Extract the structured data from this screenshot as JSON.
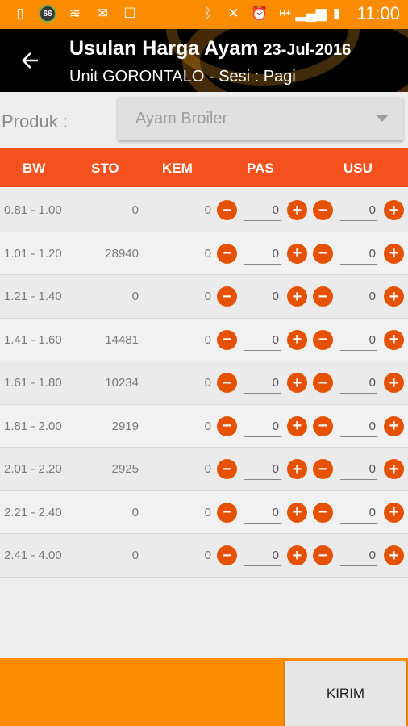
{
  "status_bar": {
    "badge": "66",
    "network": "H+",
    "time": "11:00"
  },
  "header": {
    "title": "Usulan Harga Ayam",
    "date": "23-Jul-2016",
    "subtitle": "Unit GORONTALO - Sesi : Pagi"
  },
  "produk": {
    "label": "Produk  :",
    "selected": "Ayam Broiler"
  },
  "table": {
    "columns": [
      "BW",
      "STO",
      "KEM",
      "PAS",
      "USU"
    ],
    "rows": [
      {
        "bw": "0.81 - 1.00",
        "sto": "0",
        "kem": "0",
        "pas": "0",
        "usu": "0"
      },
      {
        "bw": "1.01 - 1.20",
        "sto": "28940",
        "kem": "0",
        "pas": "0",
        "usu": "0"
      },
      {
        "bw": "1.21 - 1.40",
        "sto": "0",
        "kem": "0",
        "pas": "0",
        "usu": "0"
      },
      {
        "bw": "1.41 - 1.60",
        "sto": "14481",
        "kem": "0",
        "pas": "0",
        "usu": "0"
      },
      {
        "bw": "1.61 - 1.80",
        "sto": "10234",
        "kem": "0",
        "pas": "0",
        "usu": "0"
      },
      {
        "bw": "1.81 - 2.00",
        "sto": "2919",
        "kem": "0",
        "pas": "0",
        "usu": "0"
      },
      {
        "bw": "2.01 - 2.20",
        "sto": "2925",
        "kem": "0",
        "pas": "0",
        "usu": "0"
      },
      {
        "bw": "2.21 - 2.40",
        "sto": "0",
        "kem": "0",
        "pas": "0",
        "usu": "0"
      },
      {
        "bw": "2.41 - 4.00",
        "sto": "0",
        "kem": "0",
        "pas": "0",
        "usu": "0"
      }
    ]
  },
  "footer": {
    "submit_label": "KIRIM"
  },
  "colors": {
    "status_bar": "#fb8c00",
    "table_header": "#f4511e",
    "stepper": "#e65100"
  }
}
